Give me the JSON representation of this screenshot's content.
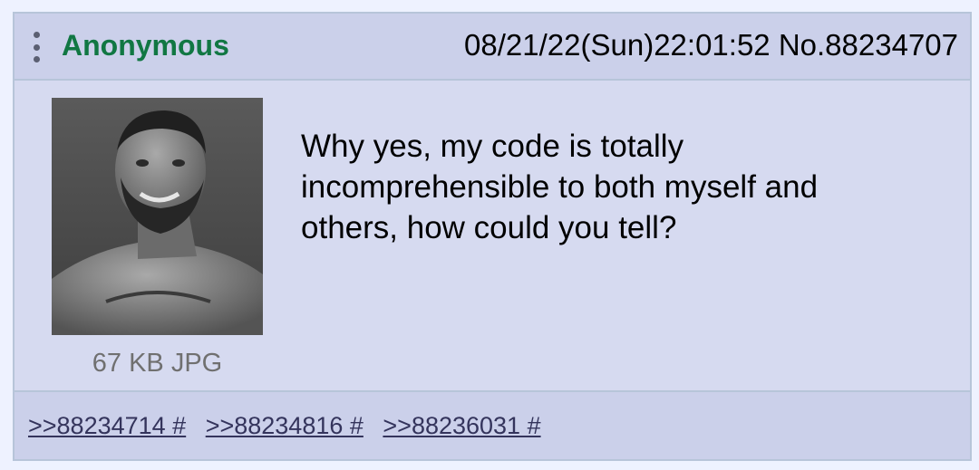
{
  "post": {
    "name": "Anonymous",
    "meta": "08/21/22(Sun)22:01:52 No.88234707",
    "message_lines": [
      "Why yes, my code is totally",
      "incomprehensible to both myself and",
      "others, how could you tell?"
    ],
    "file_info": "67 KB JPG",
    "thumbnail_icon": "photo-thumbnail",
    "replies": [
      ">>88234714 #",
      ">>88234816 #",
      ">>88236031 #"
    ]
  },
  "colors": {
    "name": "#117743",
    "post_bg": "#d6daf0",
    "header_bg": "#cbd0ea",
    "border": "#b7c5d9",
    "link": "#34345c"
  }
}
